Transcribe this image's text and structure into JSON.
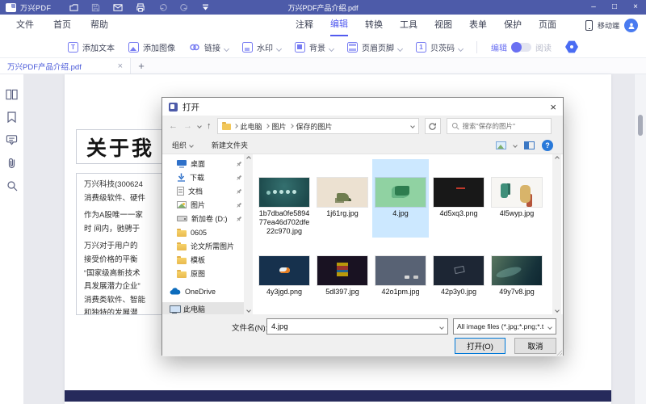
{
  "colors": {
    "titlebar": "#4d5ba9",
    "accent_purple": "#525bef",
    "selection_blue": "#cce8ff",
    "navy_footer": "#262a5b",
    "help_blue": "#2979d9"
  },
  "titlebar": {
    "app_name": "万兴PDF",
    "document_title": "万兴PDF产品介绍.pdf",
    "controls": {
      "minimize": "–",
      "maximize": "□",
      "close": "×"
    }
  },
  "menubar": {
    "left": [
      "文件",
      "首页",
      "帮助"
    ],
    "tabs": [
      "注释",
      "编辑",
      "转换",
      "工具",
      "视图",
      "表单",
      "保护",
      "页面"
    ],
    "active_tab": "编辑",
    "mobile_label": "移动端"
  },
  "toolbar": {
    "buttons": [
      {
        "label": "添加文本"
      },
      {
        "label": "添加图像"
      },
      {
        "label": "链接"
      },
      {
        "label": "水印"
      },
      {
        "label": "背景"
      },
      {
        "label": "页眉页脚"
      },
      {
        "label": "贝茨码"
      }
    ],
    "mode_toggle": {
      "edit_label": "编辑",
      "read_label": "阅读",
      "active": "编辑"
    }
  },
  "tabbar": {
    "document_tab": "万兴PDF产品介绍.pdf",
    "close_glyph": "×",
    "new_tab_glyph": "+"
  },
  "document": {
    "heading": "关于我",
    "lines": [
      "万兴科技(300624",
      "消费级软件、硬件",
      "作为A股唯一一家",
      "时 间内，驰骋于",
      "万兴对于用户的",
      "接受价格的平衡",
      "“国家级高新技术",
      "具发展潜力企业”",
      "消费类软件、智能",
      "和独特的发展潜"
    ]
  },
  "dialog": {
    "title": "打开",
    "close_glyph": "×",
    "nav": {
      "back_glyph": "←",
      "forward_glyph": "→",
      "up_glyph": "↑",
      "breadcrumb": [
        "此电脑",
        "图片",
        "保存的图片"
      ],
      "search_placeholder": "搜索\"保存的图片\""
    },
    "toolbar": {
      "organize_label": "组织",
      "new_folder_label": "新建文件夹",
      "help_glyph": "?"
    },
    "tree": [
      {
        "label": "桌面",
        "pinned": true
      },
      {
        "label": "下载",
        "pinned": true
      },
      {
        "label": "文档",
        "pinned": true
      },
      {
        "label": "图片",
        "pinned": true
      },
      {
        "label": "新加卷 (D:)",
        "pinned": true
      },
      {
        "label": "0605",
        "pinned": false
      },
      {
        "label": "论文所需图片",
        "pinned": false
      },
      {
        "label": "模板",
        "pinned": false
      },
      {
        "label": "原图",
        "pinned": false
      },
      {
        "label": "OneDrive",
        "pinned": false
      },
      {
        "label": "此电脑",
        "pinned": false,
        "selected": true
      }
    ],
    "files": [
      {
        "name": "1b7dba0fe589477ea46d702dfe22c970.jpg",
        "selected": false
      },
      {
        "name": "1j61rg.jpg",
        "selected": false
      },
      {
        "name": "4.jpg",
        "selected": true
      },
      {
        "name": "4d5xq3.png",
        "selected": false
      },
      {
        "name": "4l5wyp.jpg",
        "selected": false
      },
      {
        "name": "4y3jgd.png",
        "selected": false
      },
      {
        "name": "5dl397.jpg",
        "selected": false
      },
      {
        "name": "42o1pm.jpg",
        "selected": false
      },
      {
        "name": "42p3y0.jpg",
        "selected": false
      },
      {
        "name": "49y7v8.jpg",
        "selected": false
      }
    ],
    "footer": {
      "file_name_label": "文件名(N):",
      "file_name_value": "4.jpg",
      "file_type_value": "All image files (*.jpg;*.png;*.t",
      "open_label": "打开(O)",
      "cancel_label": "取消"
    }
  }
}
